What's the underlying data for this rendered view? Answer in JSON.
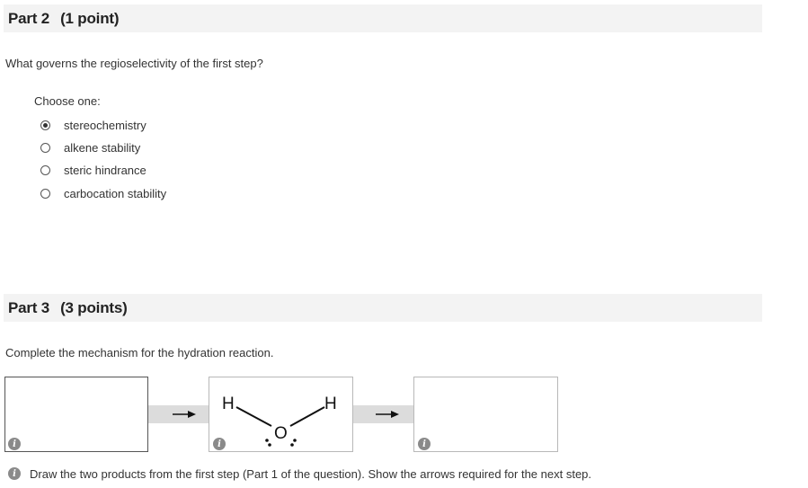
{
  "part2": {
    "title": "Part 2",
    "points": "(1 point)",
    "question": "What governs the regioselectivity of the first step?",
    "choose_label": "Choose one:",
    "options": [
      {
        "label": "stereochemistry",
        "selected": true
      },
      {
        "label": "alkene stability",
        "selected": false
      },
      {
        "label": "steric hindrance",
        "selected": false
      },
      {
        "label": "carbocation stability",
        "selected": false
      }
    ]
  },
  "part3": {
    "title": "Part 3",
    "points": "(3 points)",
    "question": "Complete the mechanism for the hydration reaction.",
    "molecule": {
      "atom_h_left": "H",
      "atom_o": "O",
      "atom_h_right": "H"
    },
    "info_icon": "i",
    "note": "Draw the two products from the first step (Part 1 of the question). Show the arrows required for the next step."
  },
  "icons": {
    "info": "info-icon",
    "arrow": "right-arrow-icon",
    "radio": "radio-icon"
  }
}
